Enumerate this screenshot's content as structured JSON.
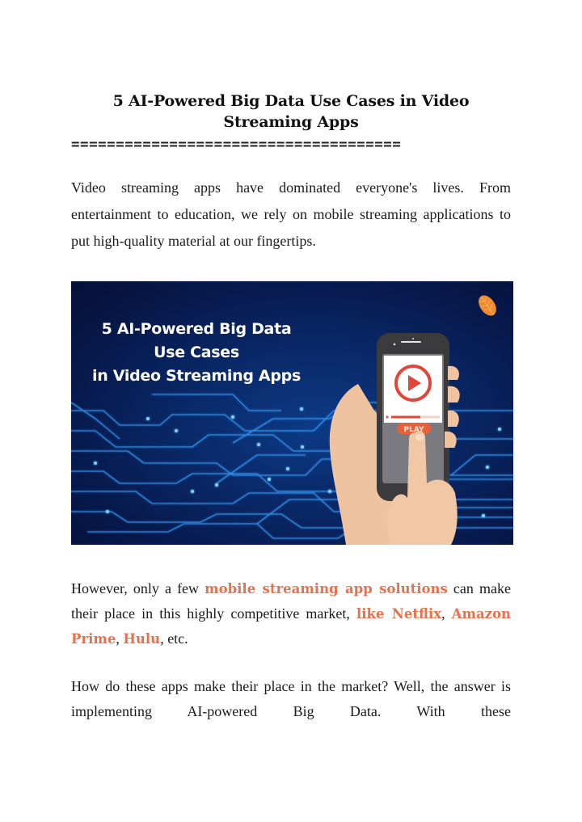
{
  "document": {
    "title": "5 AI-Powered Big Data Use Cases in Video Streaming Apps",
    "title_lines": [
      "5 AI-Powered Big Data Use Cases in Video",
      "Streaming Apps"
    ],
    "rule": "====================================="
  },
  "paragraphs": {
    "intro": "Video streaming apps have dominated everyone's lives. From entertainment to education, we rely on mobile streaming applications to put high-quality material at our fingertips.",
    "p2": {
      "t1": "However, only a few ",
      "link1": "mobile streaming app solutions",
      "t2": " can make their place in this highly competitive market, ",
      "link2": "like Netflix",
      "t3": ", ",
      "link3": "Amazon Prime",
      "t4": ", ",
      "link4": "Hulu",
      "t5": ", etc."
    },
    "p3": "How do these apps make their place in the market?  Well, the answer is implementing AI-powered Big Data. With these"
  },
  "banner": {
    "title_lines": [
      "5 AI-Powered Big Data",
      "Use Cases",
      "in Video Streaming Apps"
    ],
    "play_button_label": "PLAY",
    "logo_icon": "leaf-logo-icon",
    "video_progress": 0.6,
    "colors": {
      "background": "#071a4e",
      "circuit": "#3aa0ff",
      "accent": "#e8704a",
      "play_red": "#e0463a"
    }
  },
  "colors": {
    "link": "#e8704a",
    "text": "#1a1a1a"
  }
}
